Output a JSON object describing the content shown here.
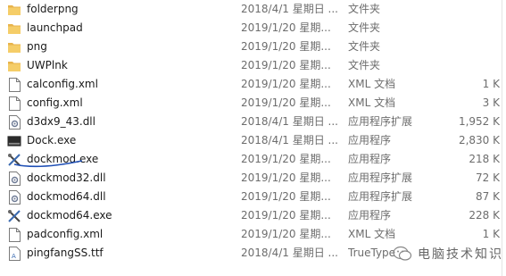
{
  "files": [
    {
      "name": "folderpng",
      "date": "2018/4/1 星期日 ...",
      "type": "文件夹",
      "size": "",
      "icon": "folder-icon"
    },
    {
      "name": "launchpad",
      "date": "2019/1/20 星期...",
      "type": "文件夹",
      "size": "",
      "icon": "folder-icon"
    },
    {
      "name": "png",
      "date": "2019/1/20 星期...",
      "type": "文件夹",
      "size": "",
      "icon": "folder-icon"
    },
    {
      "name": "UWPlnk",
      "date": "2019/1/20 星期...",
      "type": "文件夹",
      "size": "",
      "icon": "folder-icon"
    },
    {
      "name": "calconfig.xml",
      "date": "2019/1/20 星期...",
      "type": "XML 文档",
      "size": "1 K",
      "icon": "document-icon"
    },
    {
      "name": "config.xml",
      "date": "2019/1/20 星期...",
      "type": "XML 文档",
      "size": "3 K",
      "icon": "document-icon"
    },
    {
      "name": "d3dx9_43.dll",
      "date": "2018/4/1 星期日 ...",
      "type": "应用程序扩展",
      "size": "1,952 K",
      "icon": "dll-gear-icon"
    },
    {
      "name": "Dock.exe",
      "date": "2018/4/1 星期日 ...",
      "type": "应用程序",
      "size": "2,830 K",
      "icon": "dock-app-icon"
    },
    {
      "name": "dockmod.exe",
      "date": "2019/1/20 星期...",
      "type": "应用程序",
      "size": "218 K",
      "icon": "tools-icon"
    },
    {
      "name": "dockmod32.dll",
      "date": "2019/1/20 星期...",
      "type": "应用程序扩展",
      "size": "72 K",
      "icon": "dll-gear-icon"
    },
    {
      "name": "dockmod64.dll",
      "date": "2019/1/20 星期...",
      "type": "应用程序扩展",
      "size": "87 K",
      "icon": "dll-gear-icon"
    },
    {
      "name": "dockmod64.exe",
      "date": "2019/1/20 星期...",
      "type": "应用程序",
      "size": "228 K",
      "icon": "tools-icon"
    },
    {
      "name": "padconfig.xml",
      "date": "2019/1/20 星期...",
      "type": "XML 文档",
      "size": "1 K",
      "icon": "document-icon"
    },
    {
      "name": "pingfangSS.ttf",
      "date": "2018/4/1 星期日 ...",
      "type": "TrueType",
      "size": "",
      "icon": "font-file-icon"
    }
  ],
  "watermark": {
    "text": "电脑技术知识",
    "icon": "wechat-icon"
  },
  "colors": {
    "folder": "#e8b44c",
    "underline": "#1f4fb5"
  }
}
